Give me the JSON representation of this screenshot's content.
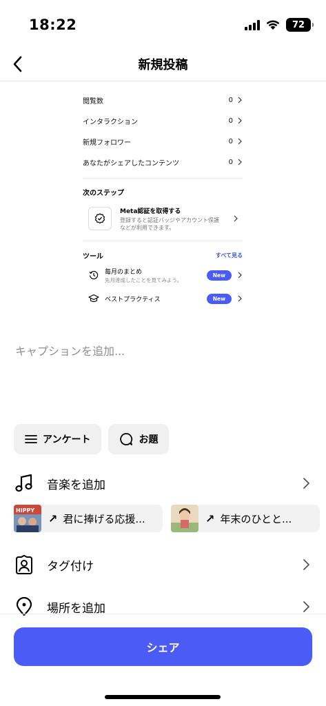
{
  "status": {
    "time": "18:22",
    "battery": "72"
  },
  "header": {
    "title": "新規投稿"
  },
  "preview": {
    "stats": [
      {
        "label": "閲覧数",
        "value": "0"
      },
      {
        "label": "インタラクション",
        "value": "0"
      },
      {
        "label": "新規フォロワー",
        "value": "0"
      },
      {
        "label": "あなたがシェアしたコンテンツ",
        "value": "0"
      }
    ],
    "next_steps_label": "次のステップ",
    "meta_title": "Meta認証を取得する",
    "meta_desc": "登録すると認証バッジやアカウント保護などが利用できます。",
    "tools_label": "ツール",
    "see_all": "すべて見る",
    "tools": [
      {
        "title": "毎月のまとめ",
        "desc": "先月達成したことを見てみよう。",
        "badge": "New"
      },
      {
        "title": "ベストプラクティス",
        "desc": "",
        "badge": "New"
      }
    ]
  },
  "caption_placeholder": "キャプションを追加...",
  "chips": [
    {
      "label": "アンケート",
      "icon": "list-icon"
    },
    {
      "label": "お題",
      "icon": "chat-bubble-icon"
    }
  ],
  "options": {
    "music": "音楽を追加",
    "tag": "タグ付け",
    "location": "場所を追加"
  },
  "music_suggestions": [
    {
      "title": "君に捧げる応援...",
      "thumb_text": "HIPPY"
    },
    {
      "title": "年末のひとと..."
    }
  ],
  "share_button": "シェア",
  "colors": {
    "accent": "#4a5cf5",
    "placeholder": "#8e8e8e",
    "chip_bg": "#f0f0f0"
  }
}
